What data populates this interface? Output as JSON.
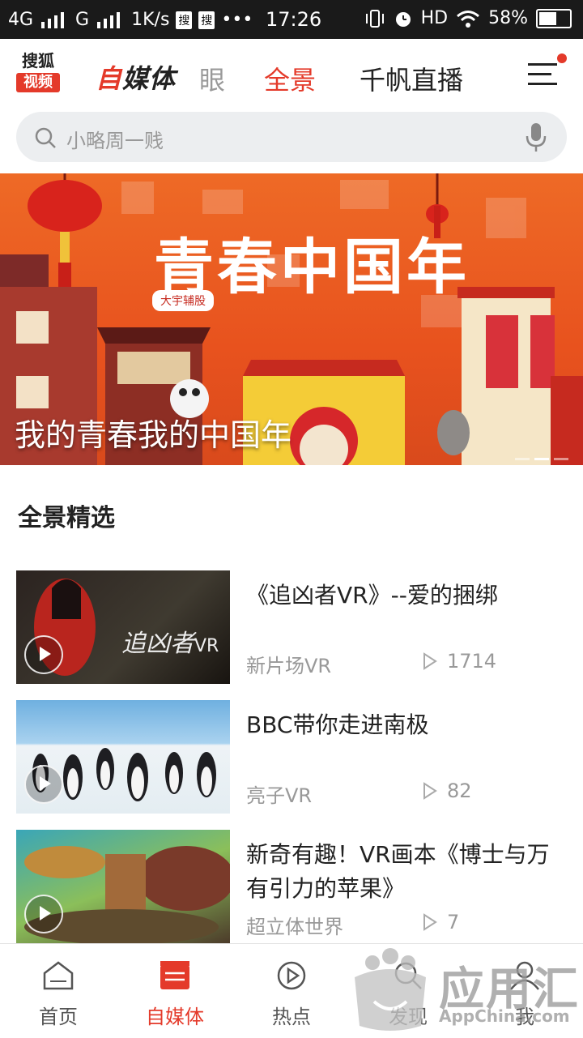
{
  "status_bar": {
    "network1": "4G",
    "network2": "G",
    "speed": "1K/s",
    "app_badge1": "搜",
    "app_badge2": "搜",
    "more": "•••",
    "time": "17:26",
    "hd": "HD",
    "battery": "58%",
    "battery_level": 0.58
  },
  "header": {
    "logo_top": "搜狐",
    "logo_bottom": "视频",
    "brand_accent": "自",
    "brand_rest": "媒体",
    "tabs": [
      {
        "label": "眼",
        "state": "faded"
      },
      {
        "label": "全景",
        "state": "active"
      },
      {
        "label": "千帆直播",
        "state": "normal"
      }
    ]
  },
  "search": {
    "placeholder": "小略周一贱"
  },
  "banner": {
    "title": "青春中国年",
    "caption": "我的青春我的中国年",
    "slide_index": 1,
    "slide_count": 3
  },
  "section": {
    "title": "全景精选",
    "items": [
      {
        "title": "《追凶者VR》--爱的捆绑",
        "source": "新片场VR",
        "views": "1714"
      },
      {
        "title": "BBC带你走进南极",
        "source": "亮子VR",
        "views": "82"
      },
      {
        "title": "新奇有趣！VR画本《博士与万有引力的苹果》",
        "source": "超立体世界",
        "views": "7"
      }
    ]
  },
  "nav": {
    "items": [
      {
        "label": "首页",
        "icon": "home-icon"
      },
      {
        "label": "自媒体",
        "icon": "clapper-icon"
      },
      {
        "label": "热点",
        "icon": "play-circle-icon"
      },
      {
        "label": "发现",
        "icon": "search-icon"
      },
      {
        "label": "我",
        "icon": "user-icon"
      }
    ],
    "active_index": 1
  },
  "watermark": {
    "big": "应用汇",
    "small": "AppChina.com"
  },
  "colors": {
    "accent": "#e43a2a",
    "banner": "#e8521e"
  }
}
